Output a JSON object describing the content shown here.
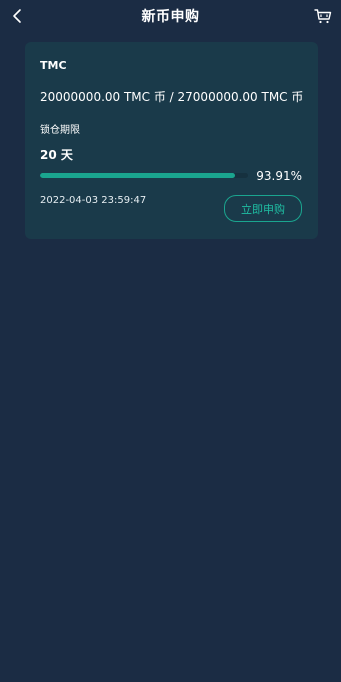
{
  "header": {
    "title": "新币申购",
    "back_icon": "chevron-left-icon",
    "cart_icon": "cart-icon"
  },
  "card": {
    "coin_name": "TMC",
    "amounts": "20000000.00 TMC 币 / 27000000.00 TMC 币",
    "lock_label": "锁仓期限",
    "lock_value": "20 天",
    "progress_fraction": 0.9391,
    "progress_text": "93.91%",
    "date": "2022-04-03 23:59:47",
    "buy_label": "立即申购"
  },
  "colors": {
    "background": "#1b2c44",
    "card": "#1a3a4a",
    "accent": "#1aa58f"
  }
}
